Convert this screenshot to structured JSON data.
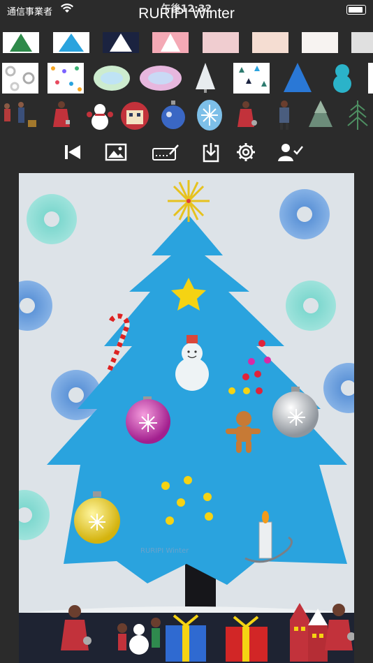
{
  "status_bar": {
    "carrier": "通信事業者",
    "time": "午後12:32"
  },
  "app": {
    "title": "RURIPI Winter"
  },
  "toolbar": {
    "icons": [
      "skip-back-icon",
      "image-icon",
      "draw-pen-icon",
      "save-download-icon",
      "settings-icon",
      "user-check-icon"
    ]
  },
  "canvas": {
    "watermark": "RURIPI Winter"
  },
  "colors": {
    "background": "#2b2b2b",
    "canvas": "#dde3e8",
    "tree": "#2aa3de",
    "ground": "#1e2332"
  }
}
